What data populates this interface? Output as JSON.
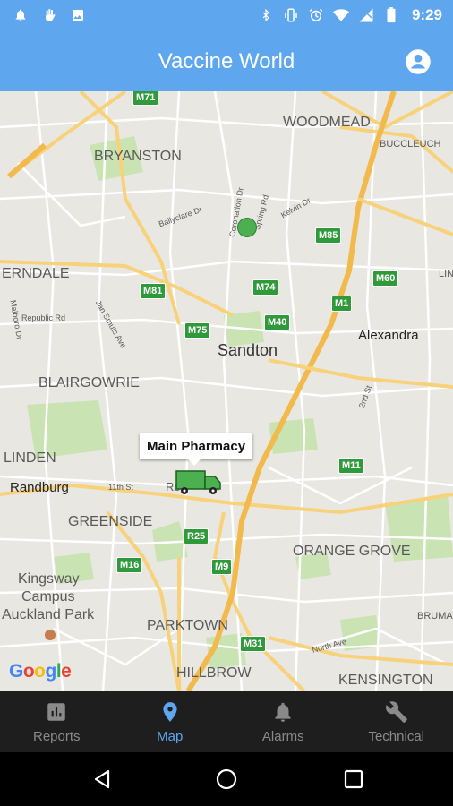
{
  "status_bar": {
    "time": "9:29"
  },
  "app_bar": {
    "title": "Vaccine World"
  },
  "map": {
    "labels": {
      "woodmead": "WOODMEAD",
      "buccleuch": "BUCCLEUCH",
      "bryanston": "BRYANSTON",
      "erndale": "ERNDALE",
      "sandton": "Sandton",
      "alexandra": "Alexandra",
      "blairgowrie": "BLAIRGOWRIE",
      "linden": "LINDEN",
      "randburg": "Randburg",
      "greenside": "GREENSIDE",
      "orange_grove": "ORANGE GROVE",
      "kingsway": "Kingsway",
      "campus": "Campus",
      "auckland_park": "Auckland Park",
      "parktown": "PARKTOWN",
      "hillbrow": "HILLBROW",
      "kensington": "KENSINGTON",
      "bruma": "BRUMA",
      "lin": "LIN",
      "republic_rd": "Republic Rd",
      "ballyclare_dr": "Ballyclare Dr",
      "jan_smuts_ave": "Jan Smuts Ave",
      "north_ave": "North Ave",
      "eleventh_st": "11th St",
      "ro": "Ro",
      "k": "k",
      "second_st": "2nd St",
      "kelvin_dr": "Kelvin Dr",
      "coronation_dr": "Coronation Dr",
      "malboro_dr": "Malboro Dr",
      "spring_rd": "Spring Rd"
    },
    "shields": [
      "M71",
      "M85",
      "M81",
      "M74",
      "M1",
      "M60",
      "M75",
      "M40",
      "M11",
      "R25",
      "M16",
      "M9",
      "M31"
    ],
    "marker_tooltip": "Main Pharmacy",
    "attribution": "Google"
  },
  "bottom_nav": [
    {
      "label": "Reports",
      "icon": "bar-chart-icon"
    },
    {
      "label": "Map",
      "icon": "location-pin-icon",
      "active": true
    },
    {
      "label": "Alarms",
      "icon": "bell-icon"
    },
    {
      "label": "Technical",
      "icon": "wrench-icon"
    }
  ],
  "colors": {
    "accent": "#5ea7ee",
    "nav_bg": "#1e1e1e",
    "marker": "#4caf50"
  }
}
